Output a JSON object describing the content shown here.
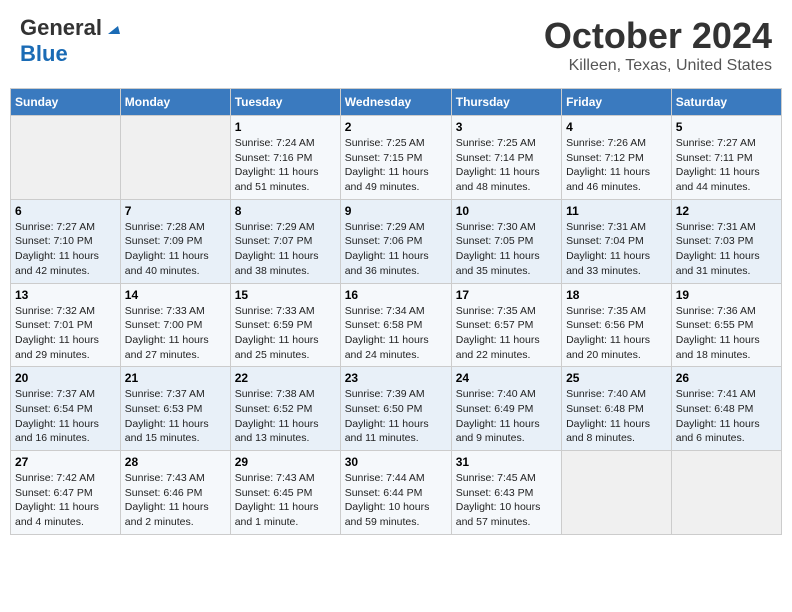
{
  "header": {
    "logo_line1": "General",
    "logo_line2": "Blue",
    "title": "October 2024",
    "subtitle": "Killeen, Texas, United States"
  },
  "days_of_week": [
    "Sunday",
    "Monday",
    "Tuesday",
    "Wednesday",
    "Thursday",
    "Friday",
    "Saturday"
  ],
  "weeks": [
    [
      {
        "day": "",
        "info": ""
      },
      {
        "day": "",
        "info": ""
      },
      {
        "day": "1",
        "info": "Sunrise: 7:24 AM\nSunset: 7:16 PM\nDaylight: 11 hours and 51 minutes."
      },
      {
        "day": "2",
        "info": "Sunrise: 7:25 AM\nSunset: 7:15 PM\nDaylight: 11 hours and 49 minutes."
      },
      {
        "day": "3",
        "info": "Sunrise: 7:25 AM\nSunset: 7:14 PM\nDaylight: 11 hours and 48 minutes."
      },
      {
        "day": "4",
        "info": "Sunrise: 7:26 AM\nSunset: 7:12 PM\nDaylight: 11 hours and 46 minutes."
      },
      {
        "day": "5",
        "info": "Sunrise: 7:27 AM\nSunset: 7:11 PM\nDaylight: 11 hours and 44 minutes."
      }
    ],
    [
      {
        "day": "6",
        "info": "Sunrise: 7:27 AM\nSunset: 7:10 PM\nDaylight: 11 hours and 42 minutes."
      },
      {
        "day": "7",
        "info": "Sunrise: 7:28 AM\nSunset: 7:09 PM\nDaylight: 11 hours and 40 minutes."
      },
      {
        "day": "8",
        "info": "Sunrise: 7:29 AM\nSunset: 7:07 PM\nDaylight: 11 hours and 38 minutes."
      },
      {
        "day": "9",
        "info": "Sunrise: 7:29 AM\nSunset: 7:06 PM\nDaylight: 11 hours and 36 minutes."
      },
      {
        "day": "10",
        "info": "Sunrise: 7:30 AM\nSunset: 7:05 PM\nDaylight: 11 hours and 35 minutes."
      },
      {
        "day": "11",
        "info": "Sunrise: 7:31 AM\nSunset: 7:04 PM\nDaylight: 11 hours and 33 minutes."
      },
      {
        "day": "12",
        "info": "Sunrise: 7:31 AM\nSunset: 7:03 PM\nDaylight: 11 hours and 31 minutes."
      }
    ],
    [
      {
        "day": "13",
        "info": "Sunrise: 7:32 AM\nSunset: 7:01 PM\nDaylight: 11 hours and 29 minutes."
      },
      {
        "day": "14",
        "info": "Sunrise: 7:33 AM\nSunset: 7:00 PM\nDaylight: 11 hours and 27 minutes."
      },
      {
        "day": "15",
        "info": "Sunrise: 7:33 AM\nSunset: 6:59 PM\nDaylight: 11 hours and 25 minutes."
      },
      {
        "day": "16",
        "info": "Sunrise: 7:34 AM\nSunset: 6:58 PM\nDaylight: 11 hours and 24 minutes."
      },
      {
        "day": "17",
        "info": "Sunrise: 7:35 AM\nSunset: 6:57 PM\nDaylight: 11 hours and 22 minutes."
      },
      {
        "day": "18",
        "info": "Sunrise: 7:35 AM\nSunset: 6:56 PM\nDaylight: 11 hours and 20 minutes."
      },
      {
        "day": "19",
        "info": "Sunrise: 7:36 AM\nSunset: 6:55 PM\nDaylight: 11 hours and 18 minutes."
      }
    ],
    [
      {
        "day": "20",
        "info": "Sunrise: 7:37 AM\nSunset: 6:54 PM\nDaylight: 11 hours and 16 minutes."
      },
      {
        "day": "21",
        "info": "Sunrise: 7:37 AM\nSunset: 6:53 PM\nDaylight: 11 hours and 15 minutes."
      },
      {
        "day": "22",
        "info": "Sunrise: 7:38 AM\nSunset: 6:52 PM\nDaylight: 11 hours and 13 minutes."
      },
      {
        "day": "23",
        "info": "Sunrise: 7:39 AM\nSunset: 6:50 PM\nDaylight: 11 hours and 11 minutes."
      },
      {
        "day": "24",
        "info": "Sunrise: 7:40 AM\nSunset: 6:49 PM\nDaylight: 11 hours and 9 minutes."
      },
      {
        "day": "25",
        "info": "Sunrise: 7:40 AM\nSunset: 6:48 PM\nDaylight: 11 hours and 8 minutes."
      },
      {
        "day": "26",
        "info": "Sunrise: 7:41 AM\nSunset: 6:48 PM\nDaylight: 11 hours and 6 minutes."
      }
    ],
    [
      {
        "day": "27",
        "info": "Sunrise: 7:42 AM\nSunset: 6:47 PM\nDaylight: 11 hours and 4 minutes."
      },
      {
        "day": "28",
        "info": "Sunrise: 7:43 AM\nSunset: 6:46 PM\nDaylight: 11 hours and 2 minutes."
      },
      {
        "day": "29",
        "info": "Sunrise: 7:43 AM\nSunset: 6:45 PM\nDaylight: 11 hours and 1 minute."
      },
      {
        "day": "30",
        "info": "Sunrise: 7:44 AM\nSunset: 6:44 PM\nDaylight: 10 hours and 59 minutes."
      },
      {
        "day": "31",
        "info": "Sunrise: 7:45 AM\nSunset: 6:43 PM\nDaylight: 10 hours and 57 minutes."
      },
      {
        "day": "",
        "info": ""
      },
      {
        "day": "",
        "info": ""
      }
    ]
  ]
}
